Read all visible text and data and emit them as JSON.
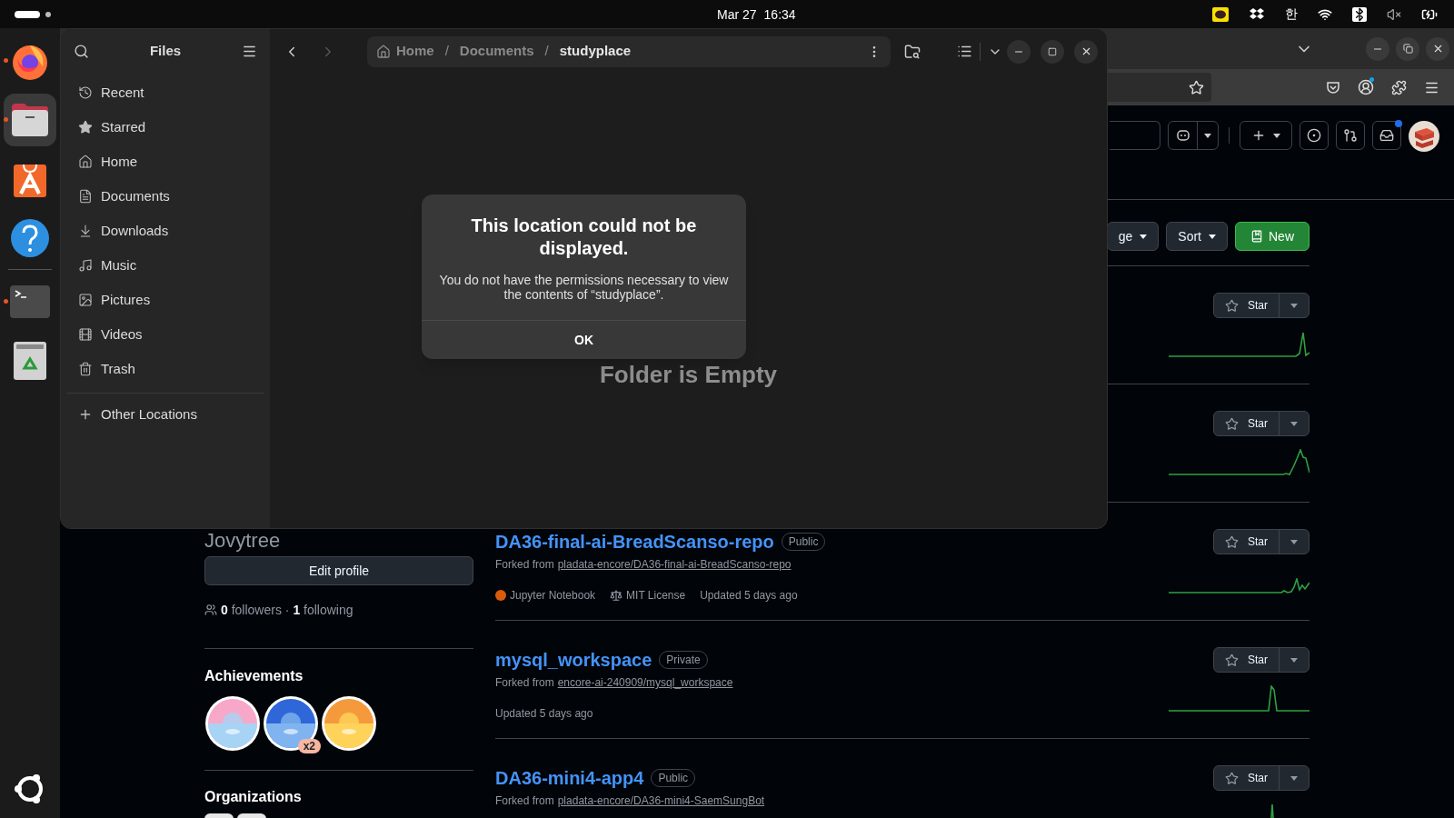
{
  "top_bar": {
    "date": "Mar 27",
    "time": "16:34",
    "input_method": "한"
  },
  "dock": [
    {
      "kind": "firefox",
      "running": true,
      "selected": false
    },
    {
      "kind": "files",
      "running": true,
      "selected": true
    },
    {
      "kind": "app-center",
      "running": false,
      "selected": false
    },
    {
      "kind": "help",
      "running": false,
      "selected": false
    },
    {
      "kind": "terminal",
      "running": true,
      "selected": false
    },
    {
      "kind": "trash",
      "running": false,
      "selected": false
    }
  ],
  "files_window": {
    "title": "Files",
    "places": [
      {
        "kind": "recent",
        "label": "Recent"
      },
      {
        "kind": "starred",
        "label": "Starred"
      },
      {
        "kind": "home",
        "label": "Home"
      },
      {
        "kind": "documents",
        "label": "Documents"
      },
      {
        "kind": "downloads",
        "label": "Downloads"
      },
      {
        "kind": "music",
        "label": "Music"
      },
      {
        "kind": "pictures",
        "label": "Pictures"
      },
      {
        "kind": "videos",
        "label": "Videos"
      },
      {
        "kind": "trash",
        "label": "Trash"
      }
    ],
    "other_locations": "Other Locations",
    "path": [
      {
        "label": "Home",
        "selected": false
      },
      {
        "label": "Documents",
        "selected": false
      },
      {
        "label": "studyplace",
        "selected": true
      }
    ],
    "path_separator": "/",
    "empty_message": "Folder is Empty",
    "dialog": {
      "title": "This location could not be displayed.",
      "message": "You do not have the permissions necessary to view the contents of “studyplace”.",
      "button": "OK"
    }
  },
  "browser": {
    "filter_buttons": [
      {
        "kind": "menu",
        "label": "ge"
      },
      {
        "kind": "menu",
        "label": "Sort"
      },
      {
        "kind": "primary",
        "label": "New"
      }
    ],
    "profile": {
      "name": "Jovytree",
      "edit_button": "Edit profile",
      "follow_text": "**0** followers · **1** following",
      "achievements_title": "Achievements",
      "achievements": [
        {
          "kind": "picture"
        },
        {
          "kind": "picture",
          "count": "x2"
        },
        {
          "kind": "picture"
        }
      ],
      "organizations_title": "Organizations"
    },
    "repositories": [
      {
        "star_label": "Star"
      },
      {
        "star_label": "Star"
      },
      {
        "star_label": "Star",
        "name": "DA36-final-ai-BreadScanso-repo",
        "visibility": "Public",
        "fork_prefix": "Forked from",
        "fork_source": "pladata-encore/DA36-final-ai-BreadScanso-repo",
        "language": "Jupyter Notebook",
        "color": "#da5b0b",
        "license": "MIT License",
        "updated": "Updated 5 days ago"
      },
      {
        "star_label": "Star",
        "name": "mysql_workspace",
        "visibility": "Private",
        "fork_prefix": "Forked from",
        "fork_source": "encore-ai-240909/mysql_workspace",
        "updated": "Updated 5 days ago"
      },
      {
        "star_label": "Star",
        "name": "DA36-mini4-app4",
        "visibility": "Public",
        "fork_prefix": "Forked from",
        "fork_source": "pladata-encore/DA36-mini4-SaemSungBot"
      }
    ]
  }
}
